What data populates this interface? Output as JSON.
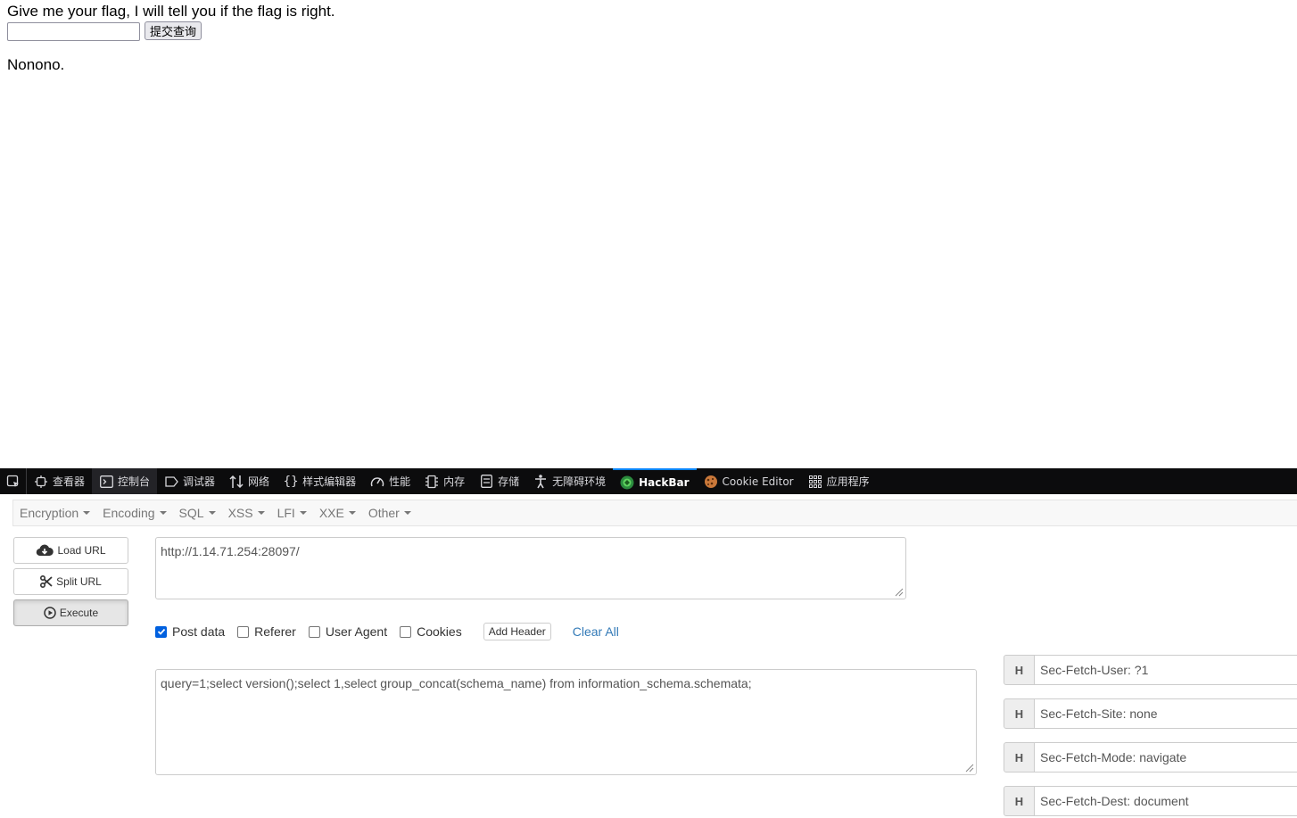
{
  "page": {
    "prompt": "Give me your flag, I will tell you if the flag is right.",
    "input_value": "",
    "submit_label": "提交查询",
    "result": "Nonono."
  },
  "devtools": {
    "tabs": [
      {
        "label": "查看器",
        "icon": "inspector-icon"
      },
      {
        "label": "控制台",
        "icon": "console-icon"
      },
      {
        "label": "调试器",
        "icon": "debugger-icon"
      },
      {
        "label": "网络",
        "icon": "network-icon"
      },
      {
        "label": "样式编辑器",
        "icon": "style-editor-icon"
      },
      {
        "label": "性能",
        "icon": "performance-icon"
      },
      {
        "label": "内存",
        "icon": "memory-icon"
      },
      {
        "label": "存储",
        "icon": "storage-icon"
      },
      {
        "label": "无障碍环境",
        "icon": "accessibility-icon"
      },
      {
        "label": "HackBar",
        "icon": "hackbar-icon"
      },
      {
        "label": "Cookie Editor",
        "icon": "cookie-icon"
      },
      {
        "label": "应用程序",
        "icon": "application-icon"
      }
    ],
    "active_tab": "HackBar"
  },
  "hackbar": {
    "menu": [
      "Encryption",
      "Encoding",
      "SQL",
      "XSS",
      "LFI",
      "XXE",
      "Other"
    ],
    "buttons": {
      "load_url": "Load URL",
      "split_url": "Split URL",
      "execute": "Execute"
    },
    "url": "http://1.14.71.254:28097/",
    "options": {
      "post_data": {
        "label": "Post data",
        "checked": true
      },
      "referer": {
        "label": "Referer",
        "checked": false
      },
      "user_agent": {
        "label": "User Agent",
        "checked": false
      },
      "cookies": {
        "label": "Cookies",
        "checked": false
      }
    },
    "add_header": "Add Header",
    "clear_all": "Clear All",
    "post_body": "query=1;select version();select 1,select group_concat(schema_name) from information_schema.schemata;",
    "headers": [
      {
        "badge": "H",
        "value": "Sec-Fetch-User: ?1"
      },
      {
        "badge": "H",
        "value": "Sec-Fetch-Site: none"
      },
      {
        "badge": "H",
        "value": "Sec-Fetch-Mode: navigate"
      },
      {
        "badge": "H",
        "value": "Sec-Fetch-Dest: document"
      }
    ]
  },
  "colors": {
    "devtools_bg": "#0c0c0d",
    "active_tab_accent": "#0a84ff",
    "checkbox_checked": "#0060df",
    "link": "#337ab7"
  }
}
